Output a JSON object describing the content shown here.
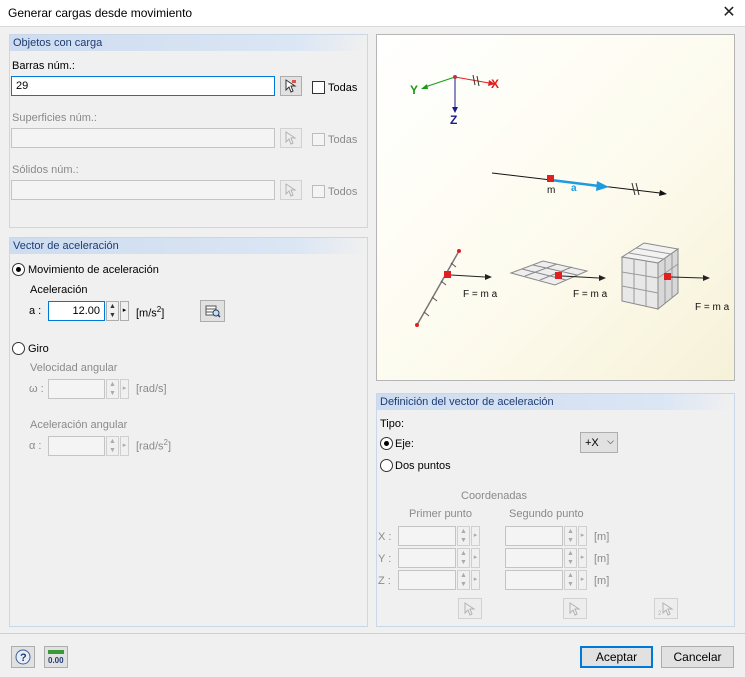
{
  "window": {
    "title": "Generar cargas desde movimiento",
    "close_glyph": "✕"
  },
  "objects": {
    "header": "Objetos con carga",
    "members_label": "Barras núm.:",
    "members_value": "29",
    "members_all": "Todas",
    "surfaces_label": "Superficies núm.:",
    "surfaces_value": "",
    "surfaces_all": "Todas",
    "solids_label": "Sólidos núm.:",
    "solids_value": "",
    "solids_all": "Todos"
  },
  "accel_vector": {
    "header": "Vector de aceleración",
    "motion_label": "Movimiento de aceleración",
    "motion_selected": true,
    "accel_label": "Aceleración",
    "a_label": "a :",
    "a_value": "12.00",
    "a_unit": "[m/s",
    "a_unit_exp": "2",
    "a_unit_close": "]",
    "rotation_label": "Giro",
    "rotation_selected": false,
    "omega_section": "Velocidad angular",
    "omega_label": "ω :",
    "omega_value": "",
    "omega_unit": "[rad/s]",
    "alpha_section": "Aceleración angular",
    "alpha_label": "α :",
    "alpha_value": "",
    "alpha_unit": "[rad/s",
    "alpha_unit_exp": "2",
    "alpha_unit_close": "]"
  },
  "illustration": {
    "axis_x": "X",
    "axis_y": "Y",
    "axis_z": "Z",
    "label_m": "m",
    "label_a": "a",
    "force_member": "F = m a",
    "force_surface": "F = m a",
    "force_solid": "F = m a"
  },
  "definition": {
    "header": "Definición del vector de aceleración",
    "type_label": "Tipo:",
    "axis_label": "Eje:",
    "axis_selected": true,
    "axis_value": "+X",
    "two_points_label": "Dos puntos",
    "two_points_selected": false,
    "coords_header": "Coordenadas",
    "first_point": "Primer punto",
    "second_point": "Segundo punto",
    "rows": [
      {
        "label": "X :",
        "p1": "",
        "p2": "",
        "unit": "[m]"
      },
      {
        "label": "Y :",
        "p1": "",
        "p2": "",
        "unit": "[m]"
      },
      {
        "label": "Z :",
        "p1": "",
        "p2": "",
        "unit": "[m]"
      }
    ]
  },
  "footer": {
    "ok": "Aceptar",
    "cancel": "Cancelar",
    "units_icon_text": "0.00"
  },
  "colors": {
    "axis_x": "#e02020",
    "axis_y": "#1a9a1a",
    "axis_z": "#1a1a8a",
    "accel_arrow": "#1e9be0",
    "accent": "#0078d7"
  }
}
